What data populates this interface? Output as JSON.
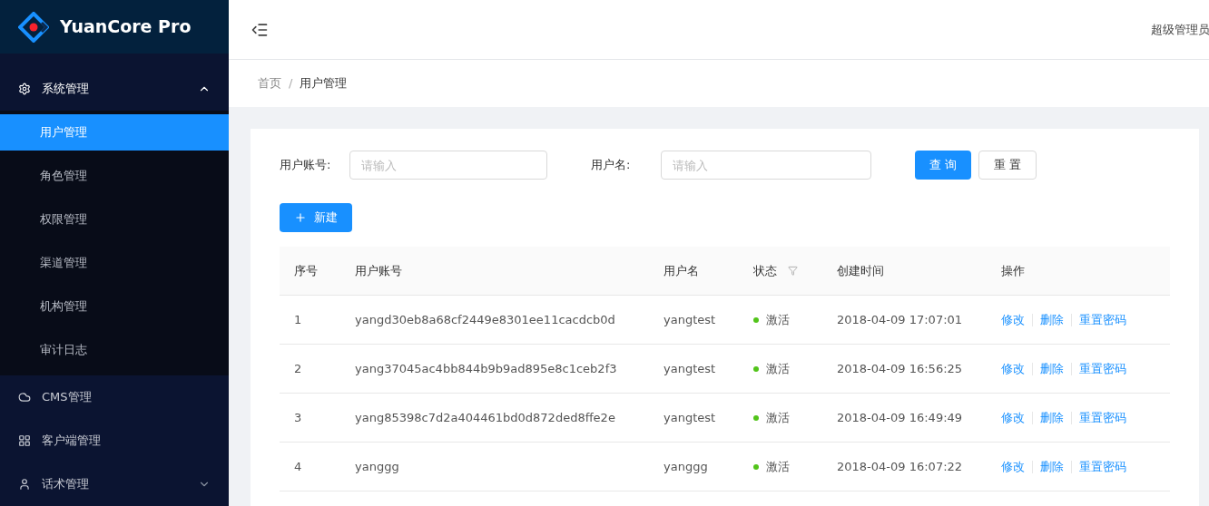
{
  "brand": {
    "title": "YuanCore Pro"
  },
  "sidebar": {
    "items": [
      {
        "label": "系统管理",
        "expanded": true,
        "children": [
          {
            "label": "用户管理",
            "selected": true
          },
          {
            "label": "角色管理",
            "selected": false
          },
          {
            "label": "权限管理",
            "selected": false
          },
          {
            "label": "渠道管理",
            "selected": false
          },
          {
            "label": "机构管理",
            "selected": false
          },
          {
            "label": "审计日志",
            "selected": false
          }
        ]
      },
      {
        "label": "CMS管理"
      },
      {
        "label": "客户端管理"
      },
      {
        "label": "话术管理",
        "expanded": false
      }
    ]
  },
  "header": {
    "user": "超级管理员"
  },
  "breadcrumb": {
    "separator": "/",
    "items": [
      "首页",
      "用户管理"
    ]
  },
  "filters": [
    {
      "label": "用户账号:",
      "placeholder": "请输入"
    },
    {
      "label": "用户名:",
      "placeholder": "请输入"
    }
  ],
  "buttons": {
    "search": "查 询",
    "reset": "重 置",
    "create": "新建"
  },
  "table": {
    "columns": [
      {
        "label": "序号"
      },
      {
        "label": "用户账号"
      },
      {
        "label": "用户名"
      },
      {
        "label": "状态",
        "filter": true
      },
      {
        "label": "创建时间"
      },
      {
        "label": "操作"
      }
    ],
    "rows": [
      {
        "index": "1",
        "account": "yangd30eb8a68cf2449e8301ee11cacdcb0d",
        "name": "yangtest",
        "status": "激活",
        "color": "#52c41a",
        "created": "2018-04-09 17:07:01",
        "actions": [
          "修改",
          "删除",
          "重置密码"
        ]
      },
      {
        "index": "2",
        "account": "yang37045ac4bb844b9b9ad895e8c1ceb2f3",
        "name": "yangtest",
        "status": "激活",
        "color": "#52c41a",
        "created": "2018-04-09 16:56:25",
        "actions": [
          "修改",
          "删除",
          "重置密码"
        ]
      },
      {
        "index": "3",
        "account": "yang85398c7d2a404461bd0d872ded8ffe2e",
        "name": "yangtest",
        "status": "激活",
        "color": "#52c41a",
        "created": "2018-04-09 16:49:49",
        "actions": [
          "修改",
          "删除",
          "重置密码"
        ]
      },
      {
        "index": "4",
        "account": "yanggg",
        "name": "yanggg",
        "status": "激活",
        "color": "#52c41a",
        "created": "2018-04-09 16:07:22",
        "actions": [
          "修改",
          "删除",
          "重置密码"
        ]
      }
    ]
  }
}
